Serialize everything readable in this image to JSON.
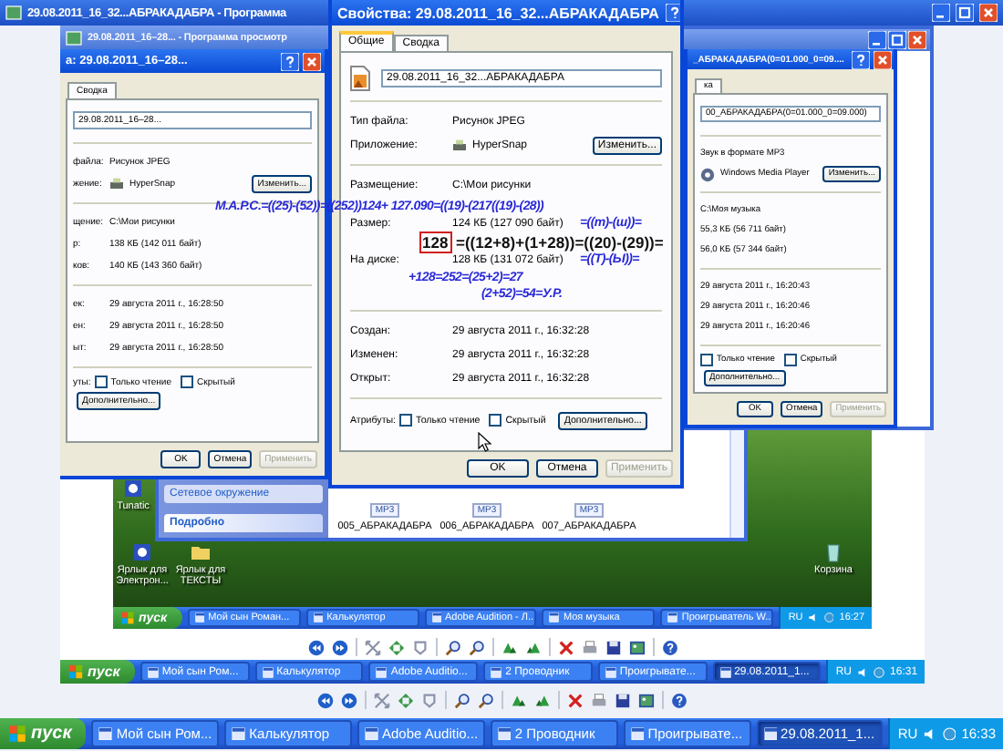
{
  "viewer_title": "29.08.2011_16_32...АБРАКАДАБРА - Программа",
  "back_viewer_title": "29.08.2011_16–28... - Программа просмотр",
  "left_dialog": {
    "title": "а: 29.08.2011_16–28...",
    "tabs": [
      {
        "label": "Сводка",
        "selected": false
      }
    ],
    "file_name": "29.08.2011_16–28...",
    "groups": [
      [
        {
          "label": "файла:",
          "value": "Рисунок JPEG"
        },
        {
          "kind": "app",
          "label": "жение:",
          "value": "HyperSnap",
          "button": "Изменить..."
        }
      ],
      [
        {
          "label": "щение:",
          "value": "C:\\Мои рисунки"
        },
        {
          "label": "р:",
          "value": "138 КБ (142 011 байт)"
        },
        {
          "label": "ков:",
          "value": "140 КБ (143 360 байт)"
        }
      ],
      [
        {
          "label": "ек:",
          "value": "29 августа 2011 г., 16:28:50"
        },
        {
          "label": "ен:",
          "value": "29 августа 2011 г., 16:28:50"
        },
        {
          "label": "ыт:",
          "value": "29 августа 2011 г., 16:28:50"
        }
      ]
    ],
    "attributes": {
      "label": "уты:",
      "checks": [
        {
          "label": "Только чтение",
          "checked": false
        },
        {
          "label": "Скрытый",
          "checked": false
        }
      ],
      "button": "Дополнительно..."
    },
    "buttons": [
      {
        "label": "OK",
        "disabled": false
      },
      {
        "label": "Отмена",
        "disabled": false
      },
      {
        "label": "Применить",
        "disabled": true
      }
    ]
  },
  "right_dialog": {
    "title": "_АБРАКАДАБРА(0=01.000_0=09....",
    "tabs": [
      {
        "label": "ка",
        "selected": false
      }
    ],
    "file_name": "00_АБРАКАДАБРА(0=01.000_0=09.000)",
    "groups": [
      [
        {
          "value": "Звук в формате MP3"
        },
        {
          "kind": "app",
          "value": "Windows Media Player",
          "button": "Изменить..."
        }
      ],
      [
        {
          "value": "C:\\Моя музыка"
        },
        {
          "value": "55,3 КБ (56 711 байт)"
        },
        {
          "value": "56,0 КБ (57 344 байт)"
        }
      ],
      [
        {
          "value": "29 августа 2011 г., 16:20:43"
        },
        {
          "value": "29 августа 2011 г., 16:20:46"
        },
        {
          "value": "29 августа 2011 г., 16:20:46"
        }
      ]
    ],
    "attributes": {
      "checks": [
        {
          "label": "Только чтение",
          "checked": false
        },
        {
          "label": "Скрытый",
          "checked": false
        }
      ],
      "button": "Дополнительно..."
    },
    "buttons": [
      {
        "label": "OK",
        "disabled": false
      },
      {
        "label": "Отмена",
        "disabled": false
      },
      {
        "label": "Применить",
        "disabled": true
      }
    ]
  },
  "front_dialog": {
    "title": "Свойства: 29.08.2011_16_32...АБРАКАДАБРА",
    "tabs": [
      {
        "label": "Общие",
        "selected": true
      },
      {
        "label": "Сводка",
        "selected": false
      }
    ],
    "file_name": "29.08.2011_16_32...АБРАКАДАБРА",
    "groups": [
      [
        {
          "label": "Тип файла:",
          "value": "Рисунок JPEG"
        },
        {
          "kind": "app",
          "label": "Приложение:",
          "value": "HyperSnap",
          "button": "Изменить..."
        }
      ],
      [
        {
          "label": "Размещение:",
          "value": "C:\\Мои рисунки"
        },
        {
          "label": "Размер:",
          "value": "124 КБ (127 090 байт)"
        },
        {
          "label": "На диске:",
          "value": "128 КБ (131 072 байт)"
        }
      ],
      [
        {
          "label": "Создан:",
          "value": "29 августа 2011 г., 16:32:28"
        },
        {
          "label": "Изменен:",
          "value": "29 августа 2011 г., 16:32:28"
        },
        {
          "label": "Открыт:",
          "value": "29 августа 2011 г., 16:32:28"
        }
      ]
    ],
    "attributes": {
      "label": "Атрибуты:",
      "checks": [
        {
          "label": "Только чтение",
          "checked": false
        },
        {
          "label": "Скрытый",
          "checked": false
        }
      ],
      "button": "Дополнительно..."
    },
    "buttons": [
      {
        "label": "OK",
        "disabled": false
      },
      {
        "label": "Отмена",
        "disabled": false
      },
      {
        "label": "Применить",
        "disabled": true
      }
    ]
  },
  "annotations": [
    {
      "kind": "handwritten",
      "text": "M.A.P.C.=((25)-(52))=((252))124+  127.090=((19)-(217((19)-(28))"
    },
    {
      "kind": "handwritten",
      "text": "=((m)-(ш))="
    },
    {
      "kind": "bold",
      "text": "128",
      "framed": true
    },
    {
      "kind": "bold",
      "text": "=((12+8)+(1+28))=((20)-(29))=",
      "framed": false
    },
    {
      "kind": "handwritten",
      "text": "=((Т)-(Ы))="
    },
    {
      "kind": "handwritten",
      "text": "+128=252=(25+2)=27"
    },
    {
      "kind": "handwritten",
      "text": "(2+52)=54=У.Р."
    }
  ],
  "desktop": {
    "icons": [
      {
        "label": "Tunatic"
      },
      {
        "label": "Ярлык для Электрон..."
      },
      {
        "label": "Ярлык для ТЕКСТЫ"
      },
      {
        "label": "Корзина"
      }
    ],
    "explorer": {
      "side_item": "Сетевое окружение",
      "details_header": "Подробно",
      "files": [
        {
          "name": "005_АБРАКАДАБРА",
          "badge": "MP3"
        },
        {
          "name": "006_АБРАКАДАБРА",
          "badge": "MP3"
        },
        {
          "name": "007_АБРАКАДАБРА",
          "badge": "MP3"
        }
      ]
    }
  },
  "inner_taskbar": {
    "start": "пуск",
    "items": [
      {
        "label": "Мой сын Роман...",
        "selected": false
      },
      {
        "label": "Калькулятор",
        "selected": false
      },
      {
        "label": "Adobe Audition - Л...",
        "selected": false
      },
      {
        "label": "Моя музыка",
        "selected": false
      },
      {
        "label": "Проигрыватель W...",
        "selected": false
      }
    ],
    "lang": "RU",
    "clock": "16:27"
  },
  "middle_taskbar": {
    "start": "пуск",
    "items": [
      {
        "label": "Мой сын Ром...",
        "selected": false
      },
      {
        "label": "Калькулятор",
        "selected": false
      },
      {
        "label": "Adobe Auditio...",
        "selected": false
      },
      {
        "label": "2 Проводник",
        "selected": false
      },
      {
        "label": "Проигрывате...",
        "selected": false
      },
      {
        "label": "29.08.2011_1...",
        "selected": true
      }
    ],
    "lang": "RU",
    "clock": "16:31"
  },
  "bottom_taskbar": {
    "start": "пуск",
    "items": [
      {
        "label": "Мой сын Ром...",
        "selected": false
      },
      {
        "label": "Калькулятор",
        "selected": false
      },
      {
        "label": "Adobe Auditio...",
        "selected": false
      },
      {
        "label": "2 Проводник",
        "selected": false
      },
      {
        "label": "Проигрывате...",
        "selected": false
      },
      {
        "label": "29.08.2011_1...",
        "selected": true
      }
    ],
    "lang": "RU",
    "clock": "16:33"
  }
}
